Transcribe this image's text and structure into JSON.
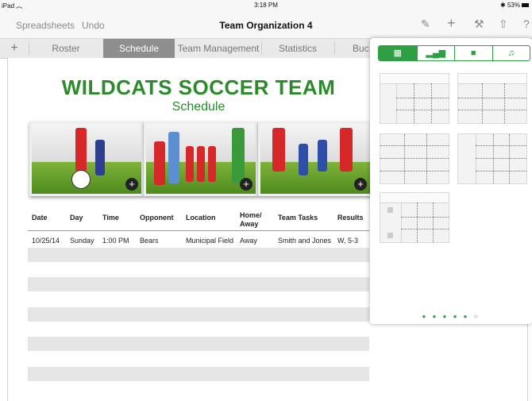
{
  "status": {
    "device": "iPad",
    "time": "3:18 PM",
    "battery": "53%"
  },
  "toolbar": {
    "back_label": "Spreadsheets",
    "undo_label": "Undo",
    "title": "Team Organization 4",
    "icons": [
      "format-brush-icon",
      "plus-icon",
      "wrench-icon",
      "share-icon",
      "help-icon"
    ]
  },
  "tabs": {
    "add_label": "+",
    "items": [
      "Roster",
      "Schedule",
      "Team Management",
      "Statistics",
      "Buc"
    ]
  },
  "sheet": {
    "title": "WILDCATS SOCCER TEAM",
    "subtitle": "Schedule",
    "photo_add": "+",
    "table": {
      "headers": [
        "Date",
        "Day",
        "Time",
        "Opponent",
        "Location",
        "Home/ Away",
        "Team Tasks",
        "Results"
      ],
      "rows": [
        [
          "10/25/14",
          "Sunday",
          "1:00 PM",
          "Bears",
          "Municipal Field",
          "Away",
          "Smith and Jones",
          "W, 5-3"
        ]
      ]
    }
  },
  "popover": {
    "segments": [
      "table-icon",
      "chart-icon",
      "shape-icon",
      "media-icon"
    ],
    "page_dots": "● ● ● ● ● ○",
    "accent": "#2ea043"
  }
}
